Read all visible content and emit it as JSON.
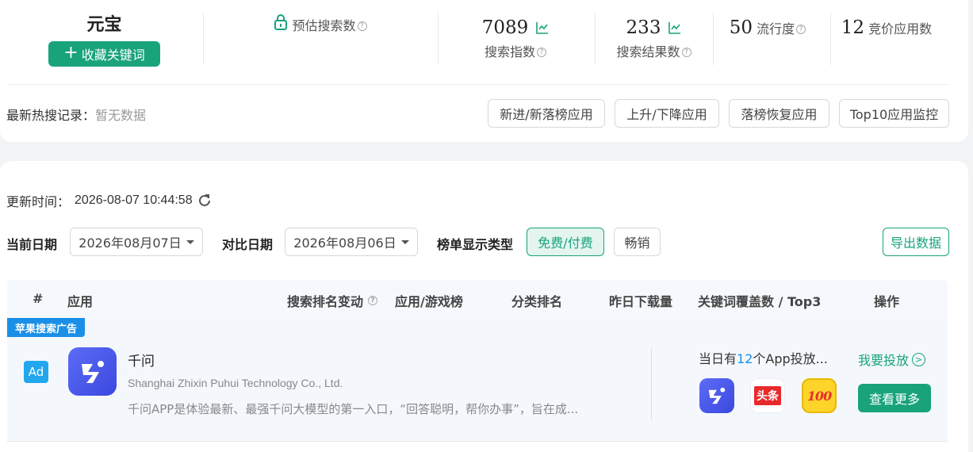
{
  "summary": {
    "app_name": "元宝",
    "favorite_button": "收藏关键词",
    "favorite_plus": "+",
    "estimated_search_label": "预估搜索数",
    "search_index_value": "7089",
    "search_index_label": "搜索指数",
    "search_results_value": "233",
    "search_results_label": "搜索结果数",
    "popularity_value": "50",
    "popularity_label": "流行度",
    "bid_apps_value": "12",
    "bid_apps_label": "竞价应用数",
    "help_glyph": "?"
  },
  "hot_search": {
    "label": "最新热搜记录：",
    "value": "暂无数据"
  },
  "quick_buttons": [
    "新进/新落榜应用",
    "上升/下降应用",
    "落榜恢复应用",
    "Top10应用监控"
  ],
  "update": {
    "label": "更新时间：",
    "time": "2026-08-07 10:44:58"
  },
  "filters": {
    "current_date_label": "当前日期",
    "current_date": "2026年08月07日",
    "compare_date_label": "对比日期",
    "compare_date": "2026年08月06日",
    "list_type_label": "榜单显示类型",
    "list_types": [
      "免费/付费",
      "畅销"
    ],
    "active_list_type": "免费/付费",
    "export": "导出数据"
  },
  "table": {
    "headers": [
      "#",
      "应用",
      "搜索排名变动",
      "应用/游戏榜",
      "分类排名",
      "昨日下载量",
      "关键词覆盖数 / Top3",
      "操作"
    ],
    "row": {
      "ad_tag": "苹果搜索广告",
      "ad_badge": "Ad",
      "name": "千问",
      "developer": "Shanghai Zhixin Puhui Technology Co., Ltd.",
      "description": "千问APP是体验最新、最强千问大模型的第一入口，“回答聪明，帮你办事”，旨在成...",
      "coverage_prefix": "当日有",
      "coverage_count": "12",
      "coverage_suffix": "个App投放...",
      "top3_icons": [
        "qianwen-icon",
        "toutiao-icon",
        "100-icon"
      ],
      "toutiao_text": "头条",
      "hundred_text": "100",
      "invest": "我要投放",
      "invest_glyph": ">",
      "view_more": "查看更多"
    }
  },
  "colors": {
    "accent": "#18a37b",
    "blue": "#1b8fe8"
  }
}
